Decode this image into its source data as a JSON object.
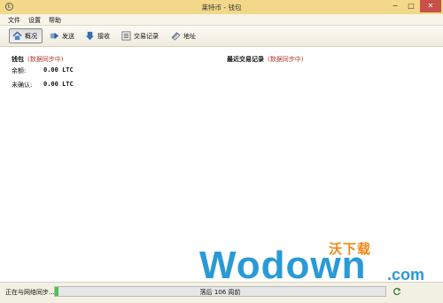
{
  "window": {
    "title": "莱特币 - 钱包",
    "controls": {
      "minimize": "−",
      "maximize": "□",
      "close": "✕"
    }
  },
  "menu": [
    "文件",
    "设置",
    "帮助"
  ],
  "toolbar": {
    "items": [
      {
        "label": "概况",
        "icon": "home-icon",
        "active": true
      },
      {
        "label": "发送",
        "icon": "send-icon",
        "active": false
      },
      {
        "label": "接收",
        "icon": "receive-icon",
        "active": false
      },
      {
        "label": "交易记录",
        "icon": "history-icon",
        "active": false
      },
      {
        "label": "地址",
        "icon": "address-book-icon",
        "active": false
      }
    ]
  },
  "wallet": {
    "title": "钱包",
    "sync_note": "(数据同步中)",
    "balance_label": "余额:",
    "balance_value": "0.00 LTC",
    "unconfirmed_label": "未确认:",
    "unconfirmed_value": "0.00 LTC"
  },
  "recent": {
    "title": "最近交易记录",
    "sync_note": "(数据同步中)"
  },
  "status": {
    "text": "正在与网络同步...",
    "progress_text": "落后 106 周前",
    "progress_fraction": 0.01
  },
  "watermark": {
    "word": "Wodown",
    "domain": ".com",
    "chinese": "沃下载"
  },
  "colors": {
    "titlebar": "#f3d88a",
    "accent_red": "#b23a2e",
    "progress_green": "#4cc34c",
    "watermark_blue": "#2a9ad7",
    "watermark_orange": "#f08a1c"
  }
}
